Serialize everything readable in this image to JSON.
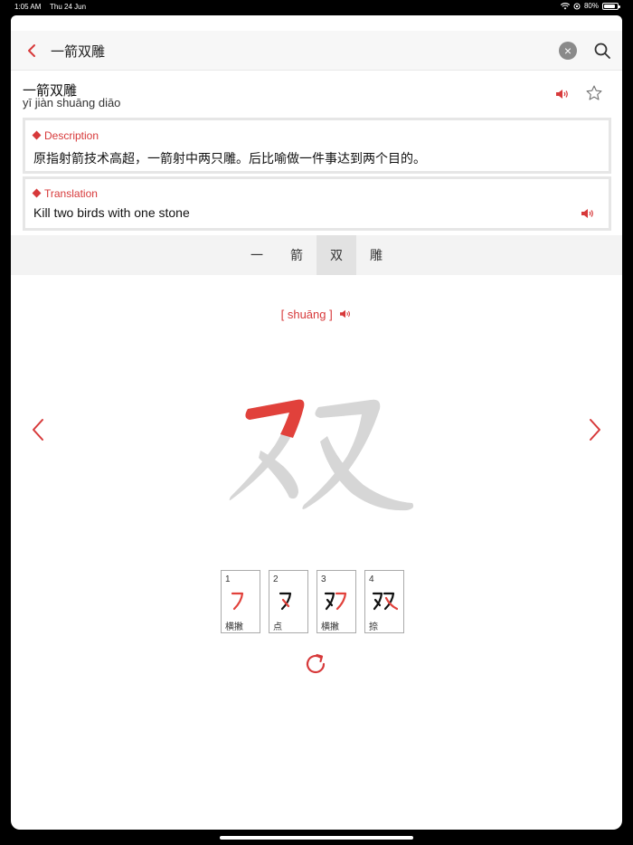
{
  "status": {
    "time": "1:05 AM",
    "date": "Thu 24 Jun",
    "battery": "80%",
    "battery_level": 0.8
  },
  "search": {
    "query": "一箭双雕"
  },
  "entry": {
    "word": "一箭双雕",
    "pinyin": "yī jiàn shuāng diāo"
  },
  "description": {
    "label": "Description",
    "text": "原指射箭技术高超，一箭射中两只雕。后比喻做一件事达到两个目的。"
  },
  "translation": {
    "label": "Translation",
    "text": "Kill two birds with one stone"
  },
  "tabs": [
    {
      "label": "一"
    },
    {
      "label": "箭"
    },
    {
      "label": "双"
    },
    {
      "label": "雕"
    }
  ],
  "active_tab": 2,
  "character": {
    "pinyin": "[ shuāng ]"
  },
  "strokes": [
    {
      "num": "1",
      "name": "横撇"
    },
    {
      "num": "2",
      "name": "点"
    },
    {
      "num": "3",
      "name": "横撇"
    },
    {
      "num": "4",
      "name": "捺"
    }
  ],
  "colors": {
    "accent": "#d7393a",
    "ghost": "#d6d6d6"
  },
  "icons": [
    "chevron-left-icon",
    "clear-icon",
    "search-icon",
    "speaker-icon",
    "star-icon",
    "chevron-right-icon",
    "replay-icon"
  ]
}
